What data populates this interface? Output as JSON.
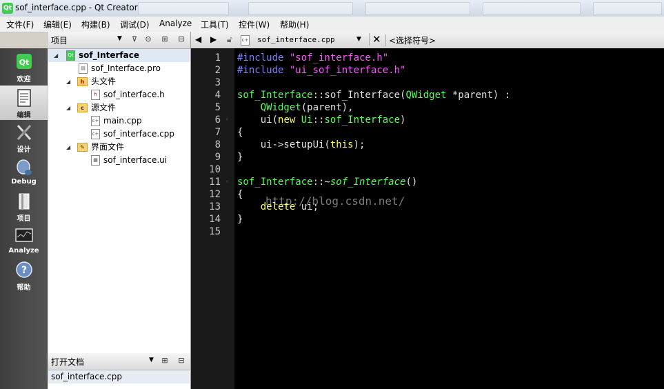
{
  "window": {
    "title": "sof_interface.cpp - Qt Creator",
    "icon": "qt-logo-icon"
  },
  "menu": [
    "文件(F)",
    "编辑(E)",
    "构建(B)",
    "调试(D)",
    "Analyze",
    "工具(T)",
    "控件(W)",
    "帮助(H)"
  ],
  "modes": [
    {
      "label": "欢迎",
      "icon": "qt-welcome-icon"
    },
    {
      "label": "编辑",
      "icon": "edit-document-icon"
    },
    {
      "label": "设计",
      "icon": "design-pen-icon"
    },
    {
      "label": "Debug",
      "icon": "debug-bug-icon"
    },
    {
      "label": "项目",
      "icon": "projects-icon"
    },
    {
      "label": "Analyze",
      "icon": "analyze-monitor-icon"
    },
    {
      "label": "帮助",
      "icon": "help-question-icon"
    }
  ],
  "project_panel": {
    "label": "项目",
    "tree": [
      {
        "label": "sof_Interface",
        "kind": "project"
      },
      {
        "label": "sof_Interface.pro",
        "kind": "pro-file"
      },
      {
        "label": "头文件",
        "kind": "folder-headers"
      },
      {
        "label": "sof_interface.h",
        "kind": "header-file"
      },
      {
        "label": "源文件",
        "kind": "folder-sources"
      },
      {
        "label": "main.cpp",
        "kind": "cpp-file"
      },
      {
        "label": "sof_interface.cpp",
        "kind": "cpp-file"
      },
      {
        "label": "界面文件",
        "kind": "folder-forms"
      },
      {
        "label": "sof_interface.ui",
        "kind": "ui-file"
      }
    ]
  },
  "open_docs": {
    "label": "打开文档",
    "items": [
      "sof_interface.cpp"
    ]
  },
  "editor": {
    "file_tab": "sof_interface.cpp",
    "symbol_selector": "<选择符号>",
    "line_numbers": [
      "1",
      "2",
      "3",
      "4",
      "5",
      "6",
      "7",
      "8",
      "9",
      "10",
      "11",
      "12",
      "13",
      "14",
      "15"
    ],
    "watermark": "http://blog.csdn.net/",
    "code": [
      [
        {
          "t": "#include ",
          "c": "#7f7fff"
        },
        {
          "t": "\"sof_interface.h\"",
          "c": "#ff55ff"
        }
      ],
      [
        {
          "t": "#include ",
          "c": "#7f7fff"
        },
        {
          "t": "\"ui_sof_interface.h\"",
          "c": "#ff55ff"
        }
      ],
      [],
      [
        {
          "t": "sof_Interface",
          "c": "#55ff55"
        },
        {
          "t": "::sof_Interface(",
          "c": "#e0e0e0"
        },
        {
          "t": "QWidget",
          "c": "#55ff55"
        },
        {
          "t": " *parent) :",
          "c": "#e0e0e0"
        }
      ],
      [
        {
          "t": "    ",
          "c": "#e0e0e0"
        },
        {
          "t": "QWidget",
          "c": "#55ff55"
        },
        {
          "t": "(parent),",
          "c": "#e0e0e0"
        }
      ],
      [
        {
          "t": "    ui(",
          "c": "#e0e0e0"
        },
        {
          "t": "new",
          "c": "#ffff55"
        },
        {
          "t": " ",
          "c": "#e0e0e0"
        },
        {
          "t": "Ui",
          "c": "#55ff55"
        },
        {
          "t": "::",
          "c": "#e0e0e0"
        },
        {
          "t": "sof_Interface",
          "c": "#55ff55"
        },
        {
          "t": ")",
          "c": "#e0e0e0"
        }
      ],
      [
        {
          "t": "{",
          "c": "#e0e0e0"
        }
      ],
      [
        {
          "t": "    ui->setupUi(",
          "c": "#e0e0e0"
        },
        {
          "t": "this",
          "c": "#ffff55"
        },
        {
          "t": ");",
          "c": "#e0e0e0"
        }
      ],
      [
        {
          "t": "}",
          "c": "#e0e0e0"
        }
      ],
      [],
      [
        {
          "t": "sof_Interface",
          "c": "#55ff55"
        },
        {
          "t": "::~",
          "c": "#e0e0e0"
        },
        {
          "t": "sof_Interface",
          "c": "#55ff55",
          "i": true
        },
        {
          "t": "()",
          "c": "#e0e0e0"
        }
      ],
      [
        {
          "t": "{",
          "c": "#e0e0e0"
        }
      ],
      [
        {
          "t": "    ",
          "c": "#e0e0e0"
        },
        {
          "t": "delete",
          "c": "#ffff55"
        },
        {
          "t": " ui;",
          "c": "#e0e0e0"
        }
      ],
      [
        {
          "t": "}",
          "c": "#e0e0e0"
        }
      ],
      []
    ]
  }
}
